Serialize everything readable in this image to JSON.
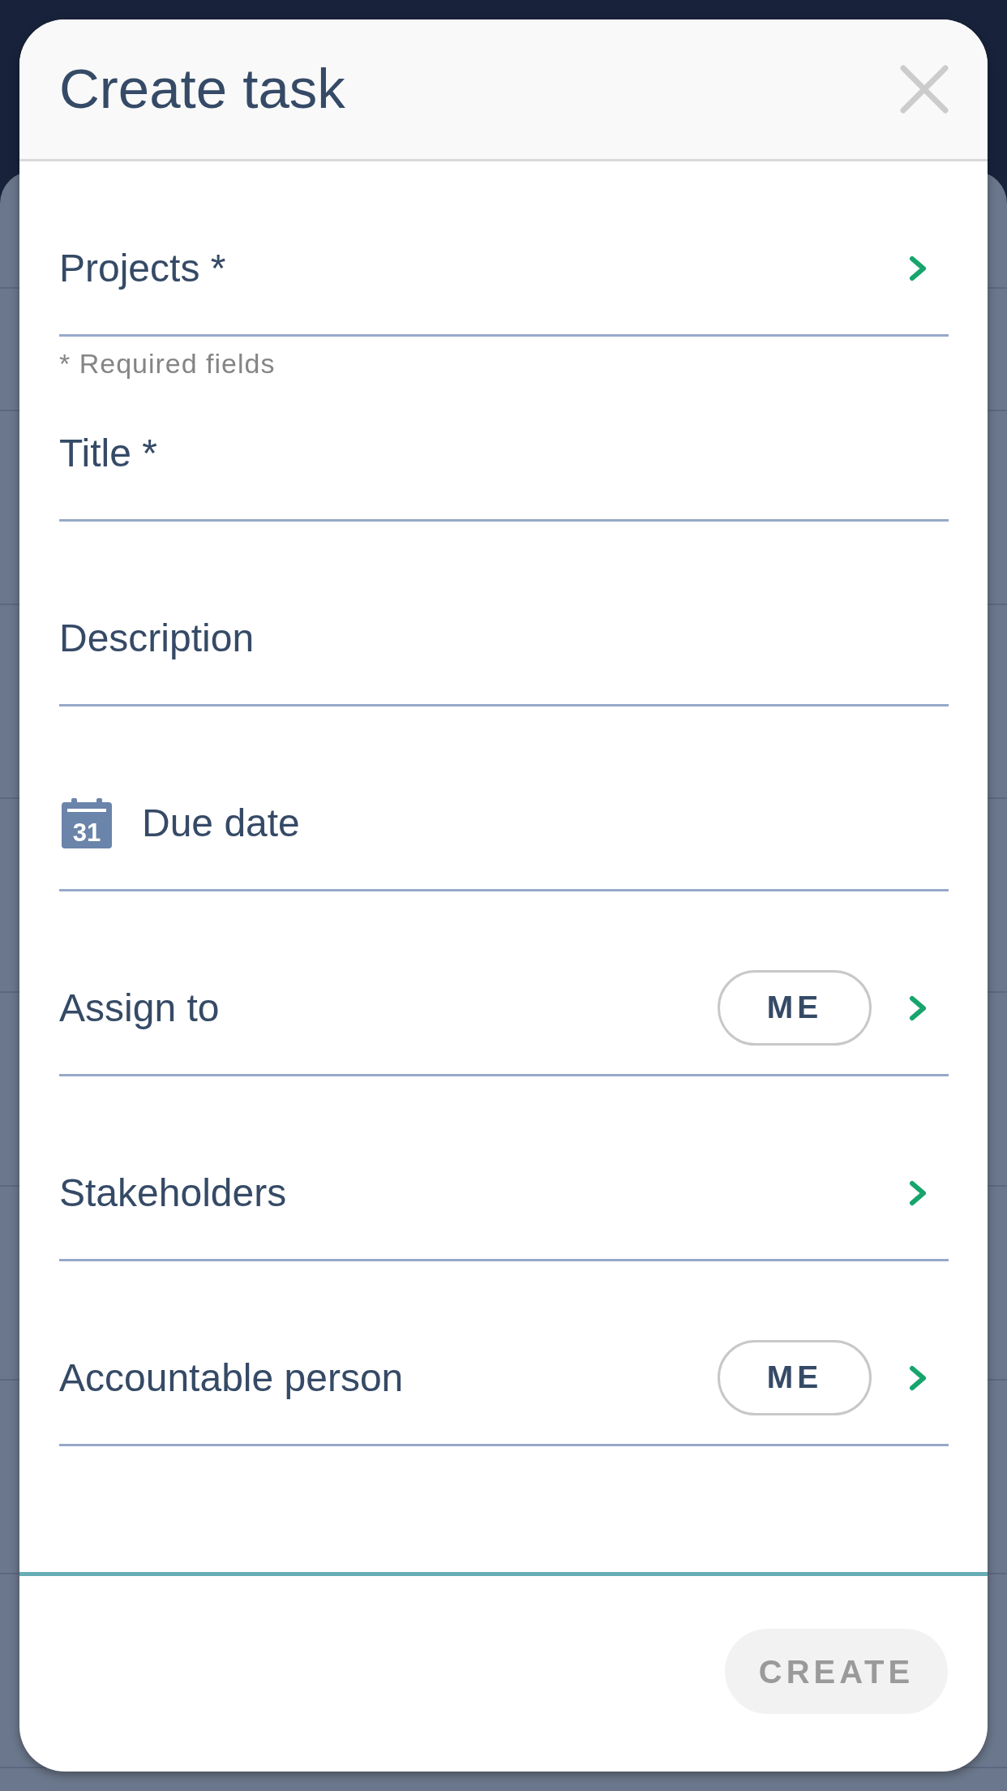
{
  "dialog": {
    "title": "Create task",
    "fields": [
      {
        "kind": "picker",
        "label": "Projects *",
        "note": "* Required fields"
      },
      {
        "kind": "input",
        "placeholder": "Title *"
      },
      {
        "kind": "input",
        "placeholder": "Description"
      },
      {
        "kind": "date",
        "placeholder": "Due date",
        "icon_day": "31"
      },
      {
        "kind": "picker",
        "label": "Assign to",
        "chip": "ME"
      },
      {
        "kind": "picker",
        "label": "Stakeholders"
      },
      {
        "kind": "picker",
        "label": "Accountable person",
        "chip": "ME"
      }
    ],
    "create_button": {
      "label": "CREATE",
      "disabled": true
    }
  }
}
